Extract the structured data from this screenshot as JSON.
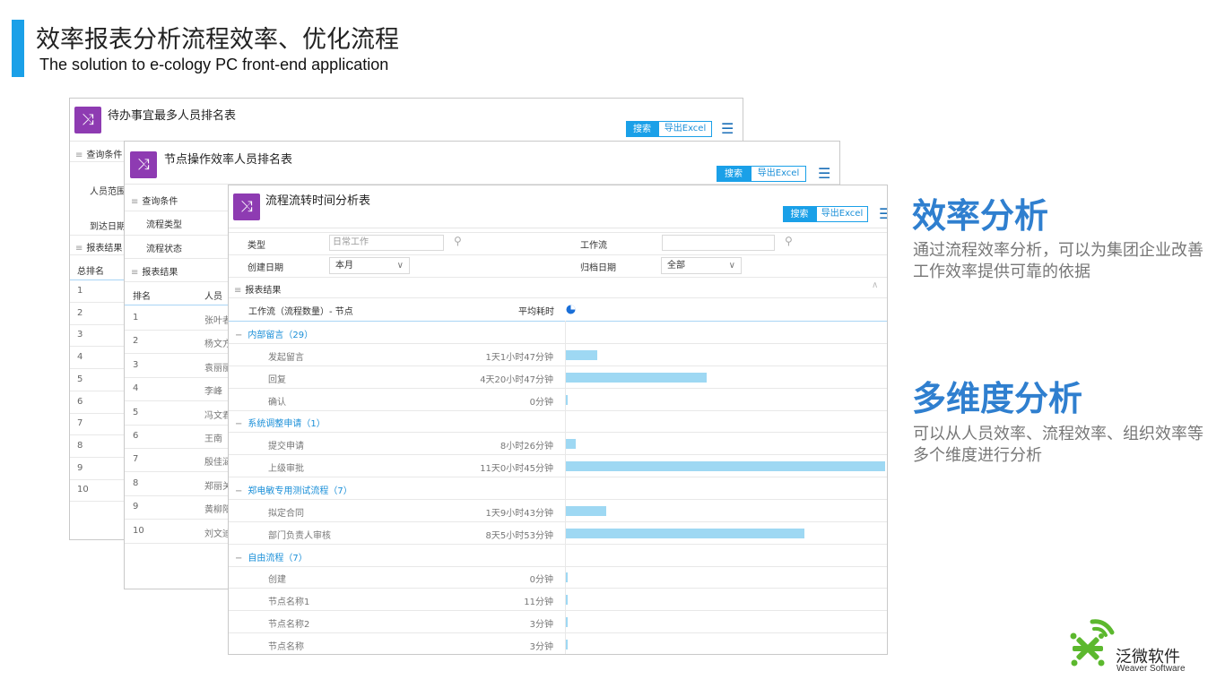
{
  "slide": {
    "title": "效率报表分析流程效率、优化流程",
    "subtitle": "The solution to e-cology PC front-end application"
  },
  "panel1": {
    "title": "待办事宜最多人员排名表",
    "search_label": "搜索",
    "export_label": "导出Excel",
    "query_label": "查询条件",
    "person_scope_label": "人员范围",
    "arrive_date_label": "到达日期",
    "results_label": "报表结果",
    "rank_header": "总排名",
    "ranks": [
      "1",
      "2",
      "3",
      "4",
      "5",
      "6",
      "7",
      "8",
      "9",
      "10"
    ]
  },
  "panel2": {
    "title": "节点操作效率人员排名表",
    "search_label": "搜索",
    "export_label": "导出Excel",
    "query_label": "查询条件",
    "wf_type_label": "流程类型",
    "wf_status_label": "流程状态",
    "results_label": "报表结果",
    "rank_header": "排名",
    "person_header": "人员",
    "rows": [
      {
        "rank": "1",
        "name": "张叶者"
      },
      {
        "rank": "2",
        "name": "杨文方"
      },
      {
        "rank": "3",
        "name": "袁丽丽"
      },
      {
        "rank": "4",
        "name": "李峰"
      },
      {
        "rank": "5",
        "name": "冯文君"
      },
      {
        "rank": "6",
        "name": "王南"
      },
      {
        "rank": "7",
        "name": "殷佳涵"
      },
      {
        "rank": "8",
        "name": "郑丽关"
      },
      {
        "rank": "9",
        "name": "黄柳阳"
      },
      {
        "rank": "10",
        "name": "刘文迪"
      }
    ]
  },
  "panel3": {
    "title": "流程流转时间分析表",
    "search_label": "搜索",
    "export_label": "导出Excel",
    "filters": {
      "type_label": "类型",
      "type_placeholder": "日常工作",
      "workflow_label": "工作流",
      "workflow_value": "",
      "create_date_label": "创建日期",
      "create_date_value": "本月",
      "archive_date_label": "归档日期",
      "archive_date_value": "全部"
    },
    "results_label": "报表结果",
    "col_workflow": "工作流（流程数量）- 节点",
    "col_avg": "平均耗时",
    "groups": [
      {
        "name": "内部留言（29）",
        "nodes": [
          {
            "name": "发起留言",
            "time": "1天1小时47分钟",
            "hours": 25.8
          },
          {
            "name": "回复",
            "time": "4天20小时47分钟",
            "hours": 116.8
          },
          {
            "name": "确认",
            "time": "0分钟",
            "hours": 0
          }
        ]
      },
      {
        "name": "系统调整申请（1）",
        "nodes": [
          {
            "name": "提交申请",
            "time": "8小时26分钟",
            "hours": 8.4
          },
          {
            "name": "上级审批",
            "time": "11天0小时45分钟",
            "hours": 264.8
          }
        ]
      },
      {
        "name": "郑电敏专用测试流程（7）",
        "nodes": [
          {
            "name": "拟定合同",
            "time": "1天9小时43分钟",
            "hours": 33.7
          },
          {
            "name": "部门负责人审核",
            "time": "8天5小时53分钟",
            "hours": 197.9
          }
        ]
      },
      {
        "name": "自由流程（7）",
        "nodes": [
          {
            "name": "创建",
            "time": "0分钟",
            "hours": 0
          },
          {
            "name": "节点名称1",
            "time": "11分钟",
            "hours": 0.18
          },
          {
            "name": "节点名称2",
            "time": "3分钟",
            "hours": 0.05
          },
          {
            "name": "节点名称",
            "time": "3分钟",
            "hours": 0.05
          }
        ]
      }
    ]
  },
  "right": {
    "head1": "效率分析",
    "desc1": "通过流程效率分析，可以为集团企业改善工作效率提供可靠的依据",
    "head2": "多维度分析",
    "desc2": "可以从人员效率、流程效率、组织效率等多个维度进行分析"
  },
  "logo": {
    "cn": "泛微软件",
    "en": "Weaver Software"
  },
  "colors": {
    "accent": "#1aa0e8",
    "icon_purple": "#8e3bb2",
    "bar": "#9ed8f3",
    "heading_blue": "#2f7fcf",
    "logo_green": "#5cb82e"
  }
}
